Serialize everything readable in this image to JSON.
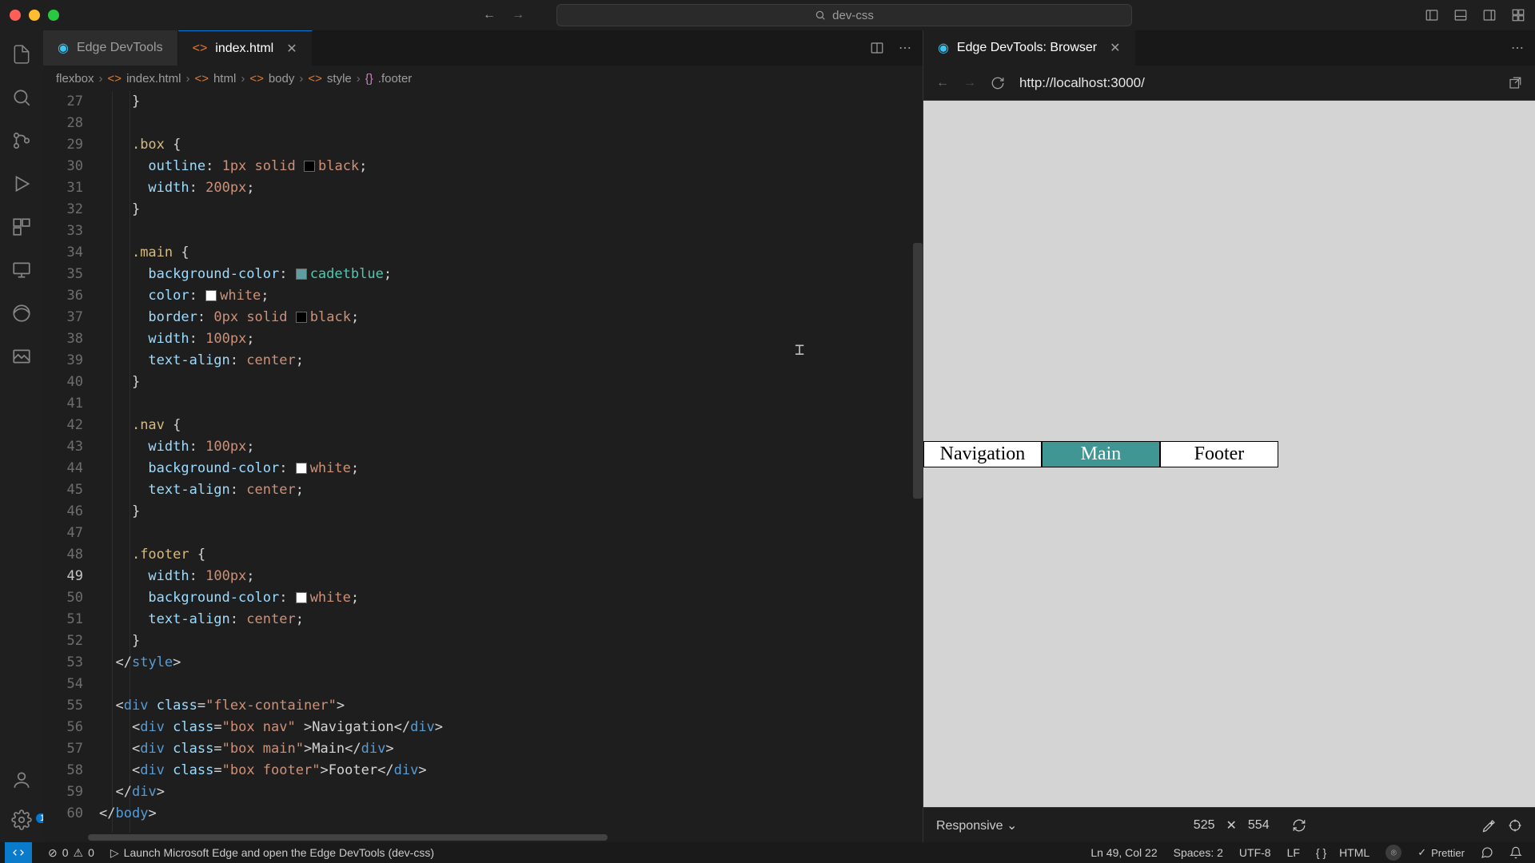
{
  "titlebar": {
    "search": "dev-css"
  },
  "tabs": {
    "devtools": "Edge DevTools",
    "indexhtml": "index.html",
    "browser": "Edge DevTools: Browser"
  },
  "breadcrumbs": [
    "flexbox",
    "index.html",
    "html",
    "body",
    "style",
    ".footer"
  ],
  "editor": {
    "startLine": 27,
    "lines": [
      {
        "n": 27,
        "html": "    <span class='pn'>}</span>"
      },
      {
        "n": 28,
        "html": ""
      },
      {
        "n": 29,
        "html": "    <span class='sel'>.box</span> <span class='pn'>{</span>"
      },
      {
        "n": 30,
        "html": "      <span class='prop'>outline</span><span class='pn'>:</span> <span class='val'>1px</span> <span class='val'>solid</span> <span class='sw' style='background:#000'></span><span class='val'>black</span><span class='pn'>;</span>"
      },
      {
        "n": 31,
        "html": "      <span class='prop'>width</span><span class='pn'>:</span> <span class='val'>200px</span><span class='pn'>;</span>"
      },
      {
        "n": 32,
        "html": "    <span class='pn'>}</span>"
      },
      {
        "n": 33,
        "html": ""
      },
      {
        "n": 34,
        "html": "    <span class='sel'>.main</span> <span class='pn'>{</span>"
      },
      {
        "n": 35,
        "html": "      <span class='prop'>background-color</span><span class='pn'>:</span> <span class='sw' style='background:#5f9ea0'></span><span class='colv'>cadetblue</span><span class='pn'>;</span>"
      },
      {
        "n": 36,
        "html": "      <span class='prop'>color</span><span class='pn'>:</span> <span class='sw' style='background:#fff'></span><span class='val'>white</span><span class='pn'>;</span>"
      },
      {
        "n": 37,
        "html": "      <span class='prop'>border</span><span class='pn'>:</span> <span class='val'>0px</span> <span class='val'>solid</span> <span class='sw' style='background:#000'></span><span class='val'>black</span><span class='pn'>;</span>"
      },
      {
        "n": 38,
        "html": "      <span class='prop'>width</span><span class='pn'>:</span> <span class='val'>100px</span><span class='pn'>;</span>"
      },
      {
        "n": 39,
        "html": "      <span class='prop'>text-align</span><span class='pn'>:</span> <span class='val'>center</span><span class='pn'>;</span>"
      },
      {
        "n": 40,
        "html": "    <span class='pn'>}</span>"
      },
      {
        "n": 41,
        "html": ""
      },
      {
        "n": 42,
        "html": "    <span class='sel'>.nav</span> <span class='pn'>{</span>"
      },
      {
        "n": 43,
        "html": "      <span class='prop'>width</span><span class='pn'>:</span> <span class='val'>100px</span><span class='pn'>;</span>"
      },
      {
        "n": 44,
        "html": "      <span class='prop'>background-color</span><span class='pn'>:</span> <span class='sw' style='background:#fff'></span><span class='val'>white</span><span class='pn'>;</span>"
      },
      {
        "n": 45,
        "html": "      <span class='prop'>text-align</span><span class='pn'>:</span> <span class='val'>center</span><span class='pn'>;</span>"
      },
      {
        "n": 46,
        "html": "    <span class='pn'>}</span>"
      },
      {
        "n": 47,
        "html": ""
      },
      {
        "n": 48,
        "html": "    <span class='sel'>.footer</span> <span class='pn'>{</span>"
      },
      {
        "n": 49,
        "current": true,
        "html": "      <span class='prop'>width</span><span class='pn'>:</span> <span class='val'>100px</span><span class='pn'>;</span>"
      },
      {
        "n": 50,
        "html": "      <span class='prop'>background-color</span><span class='pn'>:</span> <span class='sw' style='background:#fff'></span><span class='val'>white</span><span class='pn'>;</span>"
      },
      {
        "n": 51,
        "html": "      <span class='prop'>text-align</span><span class='pn'>:</span> <span class='val'>center</span><span class='pn'>;</span>"
      },
      {
        "n": 52,
        "html": "    <span class='pn'>}</span>"
      },
      {
        "n": 53,
        "html": "  <span class='pn'>&lt;/</span><span class='tg'>style</span><span class='pn'>&gt;</span>"
      },
      {
        "n": 54,
        "html": ""
      },
      {
        "n": 55,
        "html": "  <span class='pn'>&lt;</span><span class='tg'>div</span> <span class='at'>class</span><span class='pn'>=</span><span class='str'>\"flex-container\"</span><span class='pn'>&gt;</span>"
      },
      {
        "n": 56,
        "html": "    <span class='pn'>&lt;</span><span class='tg'>div</span> <span class='at'>class</span><span class='pn'>=</span><span class='str'>\"box nav\"</span> <span class='pn'>&gt;</span><span class='txt'>Navigation</span><span class='pn'>&lt;/</span><span class='tg'>div</span><span class='pn'>&gt;</span>"
      },
      {
        "n": 57,
        "html": "    <span class='pn'>&lt;</span><span class='tg'>div</span> <span class='at'>class</span><span class='pn'>=</span><span class='str'>\"box main\"</span><span class='pn'>&gt;</span><span class='txt'>Main</span><span class='pn'>&lt;/</span><span class='tg'>div</span><span class='pn'>&gt;</span>"
      },
      {
        "n": 58,
        "html": "    <span class='pn'>&lt;</span><span class='tg'>div</span> <span class='at'>class</span><span class='pn'>=</span><span class='str'>\"box footer\"</span><span class='pn'>&gt;</span><span class='txt'>Footer</span><span class='pn'>&lt;/</span><span class='tg'>div</span><span class='pn'>&gt;</span>"
      },
      {
        "n": 59,
        "html": "  <span class='pn'>&lt;/</span><span class='tg'>div</span><span class='pn'>&gt;</span>"
      },
      {
        "n": 60,
        "html": "<span class='pn'>&lt;/</span><span class='tg'>body</span><span class='pn'>&gt;</span>"
      }
    ]
  },
  "preview": {
    "url": "http://localhost:3000/",
    "nav": "Navigation",
    "main": "Main",
    "footer": "Footer",
    "deviceMode": "Responsive",
    "vw": "525",
    "vh": "554",
    "times": "✕"
  },
  "status": {
    "errors": "0",
    "warnings": "0",
    "launch": "Launch Microsoft Edge and open the Edge DevTools (dev-css)",
    "lncol": "Ln 49, Col 22",
    "spaces": "Spaces: 2",
    "encoding": "UTF-8",
    "eol": "LF",
    "lang": "HTML",
    "prettier": "Prettier"
  }
}
